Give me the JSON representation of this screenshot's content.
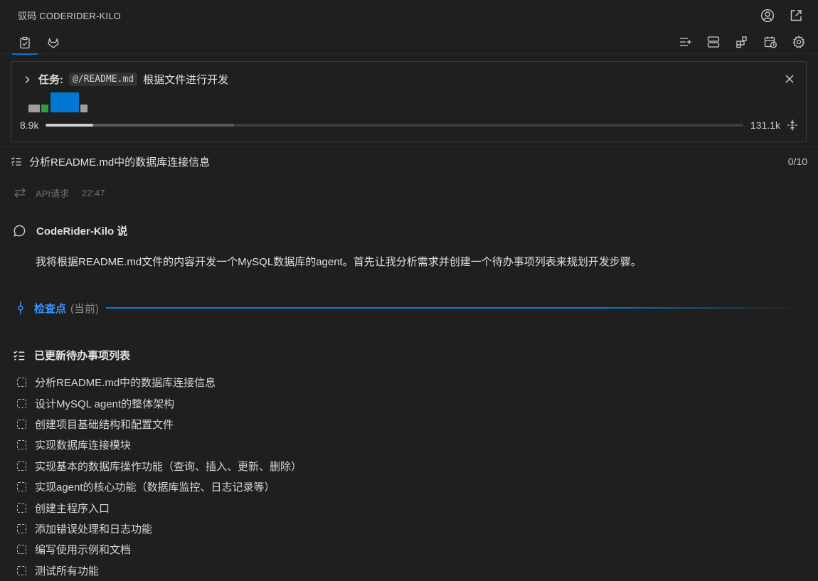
{
  "app": {
    "title": "驭码 CODERIDER-KILO"
  },
  "title_actions": [
    {
      "icon": "account-icon"
    },
    {
      "icon": "open-external-icon"
    }
  ],
  "tabs": [
    {
      "icon": "clipboard-check-icon",
      "active": true
    },
    {
      "icon": "gitlab-fox-icon",
      "active": false
    }
  ],
  "toolbar": [
    {
      "icon": "new-task-icon"
    },
    {
      "icon": "mcp-servers-icon"
    },
    {
      "icon": "extensions-icon"
    },
    {
      "icon": "history-icon"
    },
    {
      "icon": "settings-icon"
    }
  ],
  "task": {
    "label": "任务:",
    "mention": "@/README.md",
    "text": "根据文件进行开发",
    "context_used": "8.9k",
    "context_max": "131.1k",
    "context_used_fraction": 0.068,
    "context_reserved_fraction": 0.27
  },
  "progress": {
    "current_item": "分析README.md中的数据库连接信息",
    "count": "0/10"
  },
  "api": {
    "label": "API请求",
    "time": "22:47"
  },
  "speaker": {
    "name": "CodeRider-Kilo 说"
  },
  "message": "我将根据README.md文件的内容开发一个MySQL数据库的agent。首先让我分析需求并创建一个待办事项列表来规划开发步骤。",
  "checkpoint": {
    "label": "检查点",
    "sub": "(当前)"
  },
  "todo": {
    "title": "已更新待办事项列表",
    "items": [
      "分析README.md中的数据库连接信息",
      "设计MySQL agent的整体架构",
      "创建项目基础结构和配置文件",
      "实现数据库连接模块",
      "实现基本的数据库操作功能（查询、插入、更新、删除）",
      "实现agent的核心功能（数据库监控、日志记录等）",
      "创建主程序入口",
      "添加错误处理和日志功能",
      "编写使用示例和文档",
      "测试所有功能"
    ]
  },
  "colors": {
    "background": "#1f1f1f",
    "accent": "#0078d4",
    "checkpoint": "#3794ff",
    "text": "#cccccc"
  }
}
